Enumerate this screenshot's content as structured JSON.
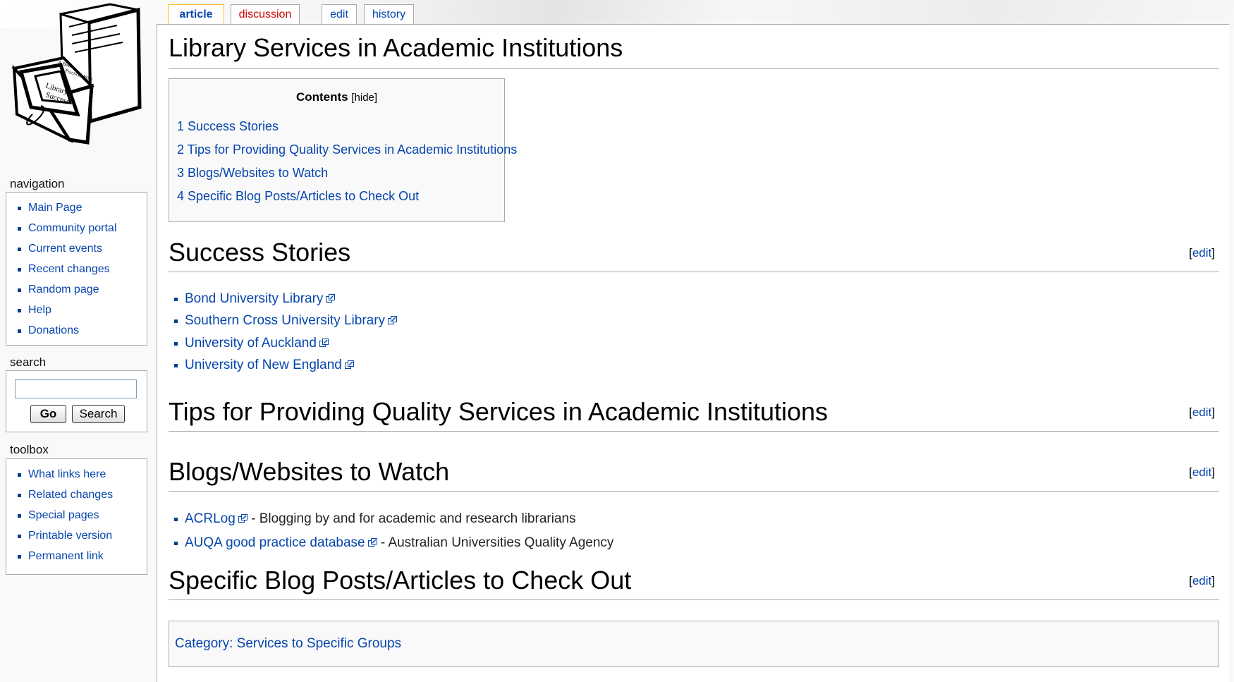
{
  "tabs": {
    "article": "article",
    "discussion": "discussion",
    "edit": "edit",
    "history": "history"
  },
  "logo_text": "A Best Practices Wiki — Library Success",
  "sidebar": {
    "navigation_title": "navigation",
    "navigation": [
      "Main Page",
      "Community portal",
      "Current events",
      "Recent changes",
      "Random page",
      "Help",
      "Donations"
    ],
    "search_title": "search",
    "search": {
      "value": "",
      "go_label": "Go",
      "search_label": "Search"
    },
    "toolbox_title": "toolbox",
    "toolbox": [
      "What links here",
      "Related changes",
      "Special pages",
      "Printable version",
      "Permanent link"
    ]
  },
  "page": {
    "title": "Library Services in Academic Institutions",
    "toc": {
      "title": "Contents",
      "hide_open": "[",
      "hide": "hide",
      "hide_close": "]",
      "items": [
        "1 Success Stories",
        "2 Tips for Providing Quality Services in Academic Institutions",
        "3 Blogs/Websites to Watch",
        "4 Specific Blog Posts/Articles to Check Out"
      ]
    },
    "edit_open": "[",
    "edit_label": "edit",
    "edit_close": "]",
    "sections": [
      {
        "heading": "Success Stories",
        "links": [
          "Bond University Library",
          "Southern Cross University Library",
          "University of Auckland",
          "University of New England"
        ]
      },
      {
        "heading": "Tips for Providing Quality Services in Academic Institutions"
      },
      {
        "heading": "Blogs/Websites to Watch",
        "links": [
          {
            "label": "ACRLog",
            "desc": " - Blogging by and for academic and research librarians"
          },
          {
            "label": "AUQA good practice database",
            "desc": " - Australian Universities Quality Agency"
          }
        ]
      },
      {
        "heading": "Specific Blog Posts/Articles to Check Out"
      }
    ],
    "category": "Category: Services to Specific Groups"
  },
  "colors": {
    "link": "#0645ad",
    "discussion_link": "#cc0000",
    "active_tab_border": "#fabd23"
  },
  "icons": [
    "external-link-icon",
    "bullet-icon"
  ]
}
